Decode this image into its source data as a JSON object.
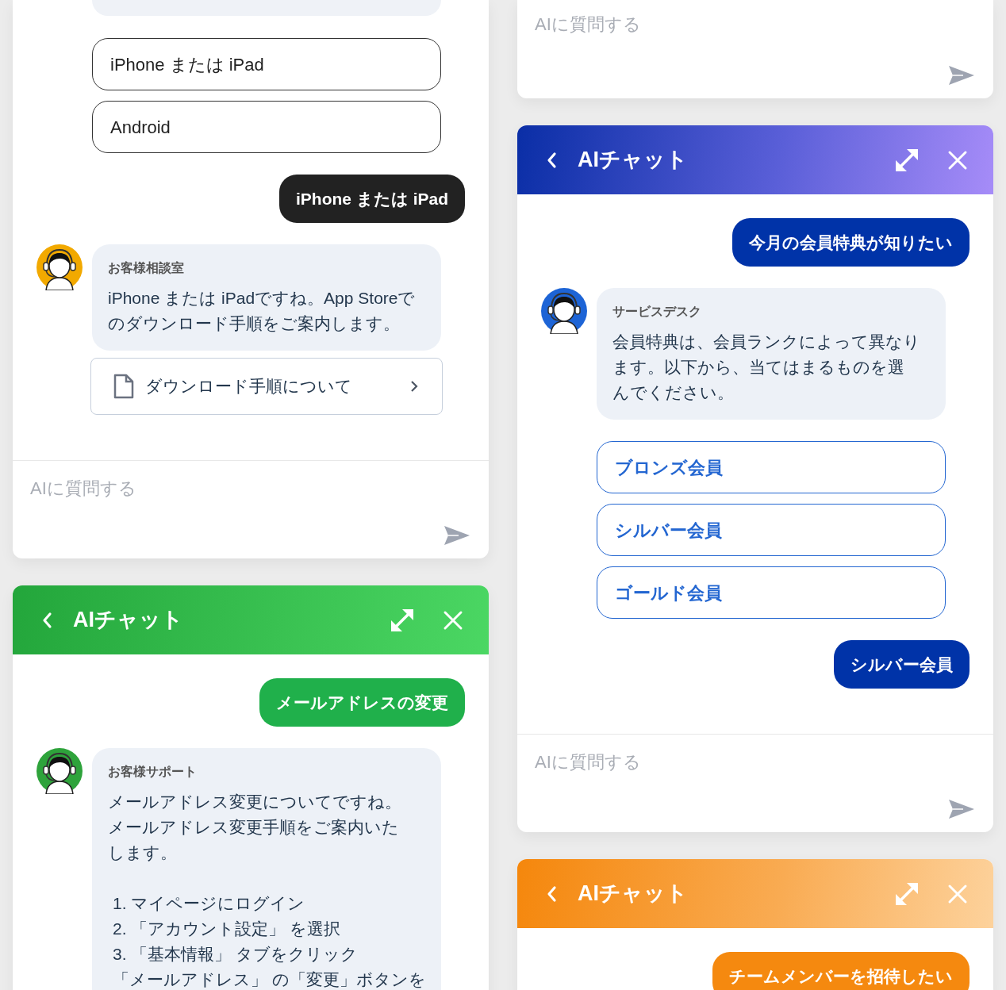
{
  "left_column": [
    {
      "kind": "mono",
      "messages": [
        {
          "kind": "fragment"
        },
        {
          "kind": "option",
          "text": "iPhone または iPad"
        },
        {
          "kind": "option",
          "text": "Android"
        },
        {
          "kind": "user",
          "text": "iPhone または iPad"
        },
        {
          "kind": "bot",
          "sender": "お客様相談室",
          "paragraphs": [
            "iPhone または iPadですね。App Storeでのダウンロード手順をご案内します。"
          ]
        },
        {
          "kind": "link",
          "text": "ダウンロード手順について"
        }
      ],
      "input": {
        "placeholder": "AIに質問する"
      }
    },
    {
      "kind": "green",
      "header": {
        "title": "AIチャット"
      },
      "messages": [
        {
          "kind": "user",
          "text": "メールアドレスの変更"
        },
        {
          "kind": "bot",
          "sender": "お客様サポート",
          "paragraphs": [
            "メールアドレス変更についてですね。",
            "メールアドレス変更手順をご案内いたします。"
          ],
          "steps": [
            "1. マイページにログイン",
            "2. 「アカウント設定」 を選択",
            "3. 「基本情報」 タブをクリック",
            "「メールアドレス」 の「変更」ボタンを"
          ]
        }
      ]
    }
  ],
  "right_column": [
    {
      "input": {
        "placeholder": "AIに質問する"
      }
    },
    {
      "kind": "blue",
      "header": {
        "title": "AIチャット"
      },
      "messages": [
        {
          "kind": "user",
          "text": "今月の会員特典が知りたい"
        },
        {
          "kind": "bot",
          "sender": "サービスデスク",
          "paragraphs": [
            "会員特典は、会員ランクによって異なります。以下から、当てはまるものを選んでください。"
          ]
        },
        {
          "kind": "option",
          "text": "ブロンズ会員"
        },
        {
          "kind": "option",
          "text": "シルバー会員"
        },
        {
          "kind": "option",
          "text": "ゴールド会員"
        },
        {
          "kind": "user",
          "text": "シルバー会員"
        }
      ],
      "input": {
        "placeholder": "AIに質問する"
      }
    },
    {
      "kind": "orange",
      "header": {
        "title": "AIチャット"
      },
      "messages": [
        {
          "kind": "user",
          "text": "チームメンバーを招待したい"
        }
      ]
    }
  ]
}
